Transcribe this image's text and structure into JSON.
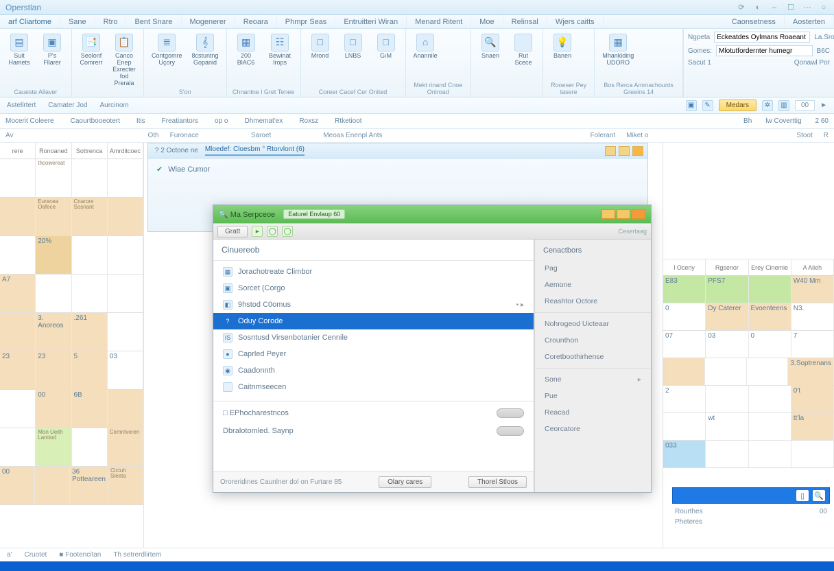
{
  "titlebar": {
    "title": "Operstlan"
  },
  "menubar": [
    "arf Cliartome",
    "Sane",
    "Rtro",
    "Bent Snare",
    "Mogenerer",
    "Reoara",
    "Phmpr Seas",
    "Entruitteri Wiran",
    "Menard Ritent",
    "Moe",
    "Relinsal",
    "Wjers caitts",
    "Caonsetness",
    "Aosterten"
  ],
  "ribbon": {
    "g1": [
      {
        "ic": "▤",
        "l1": "Suit",
        "l2": "Hamets"
      },
      {
        "ic": "▣",
        "l1": "P's",
        "l2": "Fllarer"
      }
    ],
    "g1_label": "Caueste Allaver",
    "g2": [
      {
        "ic": "📑",
        "l1": "Seolonf",
        "l2": "Comrerr"
      },
      {
        "ic": "📋",
        "l1": "Canco Enep",
        "l2": "Exrecter fod",
        "l3": "Prerala"
      }
    ],
    "g3": [
      {
        "ic": "≣",
        "l1": "Contgomre",
        "l2": "Uçory"
      },
      {
        "ic": "𝄞",
        "l1": "8cstuntng",
        "l2": "Gopanid"
      },
      {
        "ic": "",
        "l1": "S'on"
      }
    ],
    "g4": [
      {
        "ic": "▦",
        "l1": "200 BlAC6"
      },
      {
        "ic": "☷",
        "l1": "Bewinat Irops"
      },
      {
        "ic": "",
        "l1": "Chnantne l Gret",
        "l2": "Tenee"
      }
    ],
    "g5": [
      {
        "ic": "□",
        "l1": "Mrond"
      },
      {
        "ic": "□",
        "l1": "LNBS"
      },
      {
        "ic": "□",
        "l1": "GıM"
      },
      {
        "ic": "",
        "l1": "Coreer Cacef Cer",
        "l2": "Onited"
      }
    ],
    "g6": [
      {
        "ic": "⌂",
        "l1": "Anannile"
      },
      {
        "ic": "",
        "l1": "Mekt rinand Cnoe",
        "l2": "Oniroad"
      }
    ],
    "g7": [
      {
        "ic": "🔍",
        "l1": "Snaen"
      },
      {
        "ic": "",
        "l1": "Rut Scece"
      }
    ],
    "g8": [
      {
        "ic": "💡",
        "l1": "Banen"
      },
      {
        "ic": "",
        "l1": "Rooeser",
        "l2": "Pey tasere"
      }
    ],
    "g9": [
      {
        "ic": "▦",
        "l1": "Mhankiding",
        "l2": "UDORO"
      },
      {
        "ic": "",
        "l1": "Bos Rerca",
        "l2": "Ammachounts",
        "l3": "Greeins 14"
      }
    ]
  },
  "ribbon_side": {
    "r1_label": "Ngpeta",
    "r1_val": "Eckeatdes Oylmans Roaeant",
    "r2_label": "Gomes:",
    "r2_val": "Mlotutfordernter humegr",
    "r3_label": "Sacut 1",
    "r4_label": "La.Sronceso",
    "r5_label": "B6C",
    "r6_label": "Qonawl Por"
  },
  "subbar": {
    "left": [
      "Astellrtert",
      "Camater Jod",
      "Aurcinom"
    ],
    "search_label": "Medars",
    "counter": "00",
    "arrow": "►"
  },
  "hdr2": {
    "left": [
      "Mocerit Coleere",
      "Caourtbooeotert",
      "Itis",
      "Freatiantors"
    ],
    "mid": [
      "op o",
      "Dhmemat'ex",
      "Roxsz",
      "Rtketioot"
    ],
    "right": [
      "Bh",
      "lw Coverttig",
      "2 60"
    ]
  },
  "labrow": [
    "Av",
    "Oth",
    "Furonace",
    "Saroet",
    "Meoas Enenpl Ants",
    "Folerant",
    "Miket o",
    "Stoot",
    "R"
  ],
  "calhead": [
    "rere",
    "Ronoaned",
    "Sottrenca",
    "Amrditcoec"
  ],
  "calcells": [
    [
      {
        "n": "",
        "c": "wht"
      },
      {
        "n": "",
        "note": "thcowereat",
        "c": "wht"
      },
      {
        "n": "",
        "c": "wht"
      },
      {
        "n": "",
        "c": "wht"
      }
    ],
    [
      {
        "n": "",
        "c": "tan"
      },
      {
        "n": "",
        "note": "Eurecea Oafece",
        "c": "tan"
      },
      {
        "n": "",
        "note": "Cnarore Sosnant",
        "c": "tan"
      },
      {
        "n": "",
        "c": "tan"
      }
    ],
    [
      {
        "n": "",
        "c": "wht"
      },
      {
        "n": "20%",
        "c": "tan2"
      },
      {
        "n": "",
        "c": "wht"
      },
      {
        "n": "",
        "c": "wht"
      }
    ],
    [
      {
        "n": "A7",
        "c": "tan"
      },
      {
        "n": "",
        "c": "wht"
      },
      {
        "n": "",
        "c": "wht"
      },
      {
        "n": "",
        "c": "wht"
      }
    ],
    [
      {
        "n": "",
        "c": "tan"
      },
      {
        "n": "3. Anoreos",
        "c": "tan"
      },
      {
        "n": ".261",
        "c": "tan"
      },
      {
        "n": "",
        "c": "wht"
      }
    ],
    [
      {
        "n": "23",
        "c": "tan"
      },
      {
        "n": "23",
        "c": "tan"
      },
      {
        "n": "5",
        "c": "tan"
      },
      {
        "n": "03",
        "c": "wht"
      }
    ],
    [
      {
        "n": "",
        "c": "wht"
      },
      {
        "n": "00",
        "c": "tan"
      },
      {
        "n": "6B",
        "c": "tan"
      },
      {
        "n": "",
        "c": "tan"
      }
    ],
    [
      {
        "n": "",
        "c": "wht"
      },
      {
        "n": "",
        "note": "Mon Ueith Lamtod",
        "c": "grn"
      },
      {
        "n": "",
        "c": "wht"
      },
      {
        "n": "",
        "note": "Cemntveren",
        "c": "tan"
      }
    ],
    [
      {
        "n": "00",
        "c": "tan"
      },
      {
        "n": "",
        "c": "tan"
      },
      {
        "n": "36 Potteareen",
        "c": "tan"
      },
      {
        "n": "",
        "note": "Clctuh Sleeta",
        "c": "tan"
      }
    ]
  ],
  "rightTopTabs": [
    "Folerant",
    "Miket",
    "o"
  ],
  "calheadR": [
    "l Oceny",
    "Rgsenor",
    "Erey Cinemie",
    "A Alieh"
  ],
  "calcellsR": [
    [
      {
        "n": "E83",
        "c": "grn2"
      },
      {
        "n": "PFS7",
        "c": "grn2"
      },
      {
        "n": "",
        "c": "grn2"
      },
      {
        "n": "W40 Mm",
        "c": "tan"
      }
    ],
    [
      {
        "n": "0",
        "c": "wht"
      },
      {
        "n": "Dy Caterer",
        "c": "tan"
      },
      {
        "n": "Evoenteens",
        "c": "tan"
      },
      {
        "n": "N3.",
        "c": "wht"
      }
    ],
    [
      {
        "n": "07",
        "c": "wht"
      },
      {
        "n": "03",
        "c": "wht"
      },
      {
        "n": "0",
        "c": "wht"
      },
      {
        "n": "7",
        "c": "wht"
      }
    ],
    [
      {
        "n": "",
        "c": "tan"
      },
      {
        "n": "",
        "c": "wht"
      },
      {
        "n": "",
        "c": "wht"
      },
      {
        "n": "3.Soptrenans",
        "c": "tan"
      }
    ],
    [
      {
        "n": "2",
        "c": "wht"
      },
      {
        "n": "",
        "c": "wht"
      },
      {
        "n": "",
        "c": "wht"
      },
      {
        "n": "0't",
        "c": "tan"
      }
    ],
    [
      {
        "n": "",
        "c": "wht"
      },
      {
        "n": "wt",
        "c": "wht"
      },
      {
        "n": "",
        "c": "wht"
      },
      {
        "n": "tt'la",
        "c": "tan"
      }
    ],
    [
      {
        "n": "033",
        "c": "blue"
      },
      {
        "n": "",
        "c": "wht"
      },
      {
        "n": "",
        "c": "wht"
      },
      {
        "n": "",
        "c": "wht"
      }
    ]
  ],
  "wswin": {
    "tabs": [
      "? 2 Octone ne",
      "Mloedef: Cloesbm  ° Rtorvlont (6)",
      "",
      "",
      ""
    ],
    "green_item": "Wiae Cumor"
  },
  "dialog": {
    "title_items": [
      "🔍 Ma Serpceoe",
      "Eaturel Envlaup 60"
    ],
    "tool_btn": "Gratt",
    "header": "Cinuereob",
    "items": [
      {
        "ic": "▦",
        "t": "Jorachotreate Climbor"
      },
      {
        "ic": "▣",
        "t": "Sorcet (Corgo"
      },
      {
        "ic": "◧",
        "t": "9hstod C0omus",
        "arrow": true
      },
      {
        "ic": "?",
        "t": "Oduy Corode",
        "sel": true
      },
      {
        "ic": "IS",
        "t": "Sosntusd Virsenbotanier Cennile"
      },
      {
        "ic": "●",
        "t": "Caprled Peyer"
      },
      {
        "ic": "◉",
        "t": "Caadonnth"
      },
      {
        "ic": "",
        "t": "Caitnmseecen"
      }
    ],
    "opt1": "□ EPhocharestncos",
    "opt2": "Dbralotomled. Saynp",
    "foot1": "Ororeridines Caunlner dol on Furtare 85",
    "foot_btn1": "Olary cares",
    "foot_btn2": "Thorel Stloos",
    "side_label": "Cesertaag",
    "right_hdr": "Cenactbors",
    "right_items": [
      "Pag",
      "Aemone",
      "Reashtor Octore",
      "Nohrogeod Uicteaar",
      "Crounthon",
      "Coretboothirhense",
      "Sone",
      "Pue",
      "Reacad",
      "Ceorcatore"
    ]
  },
  "rightlow": {
    "r1": "Rourthes",
    "r1v": "00",
    "r2": "Pheteres"
  },
  "status": [
    "a'",
    "Cruotet",
    "■ Footencitan",
    "Th setrerdlirtem"
  ]
}
